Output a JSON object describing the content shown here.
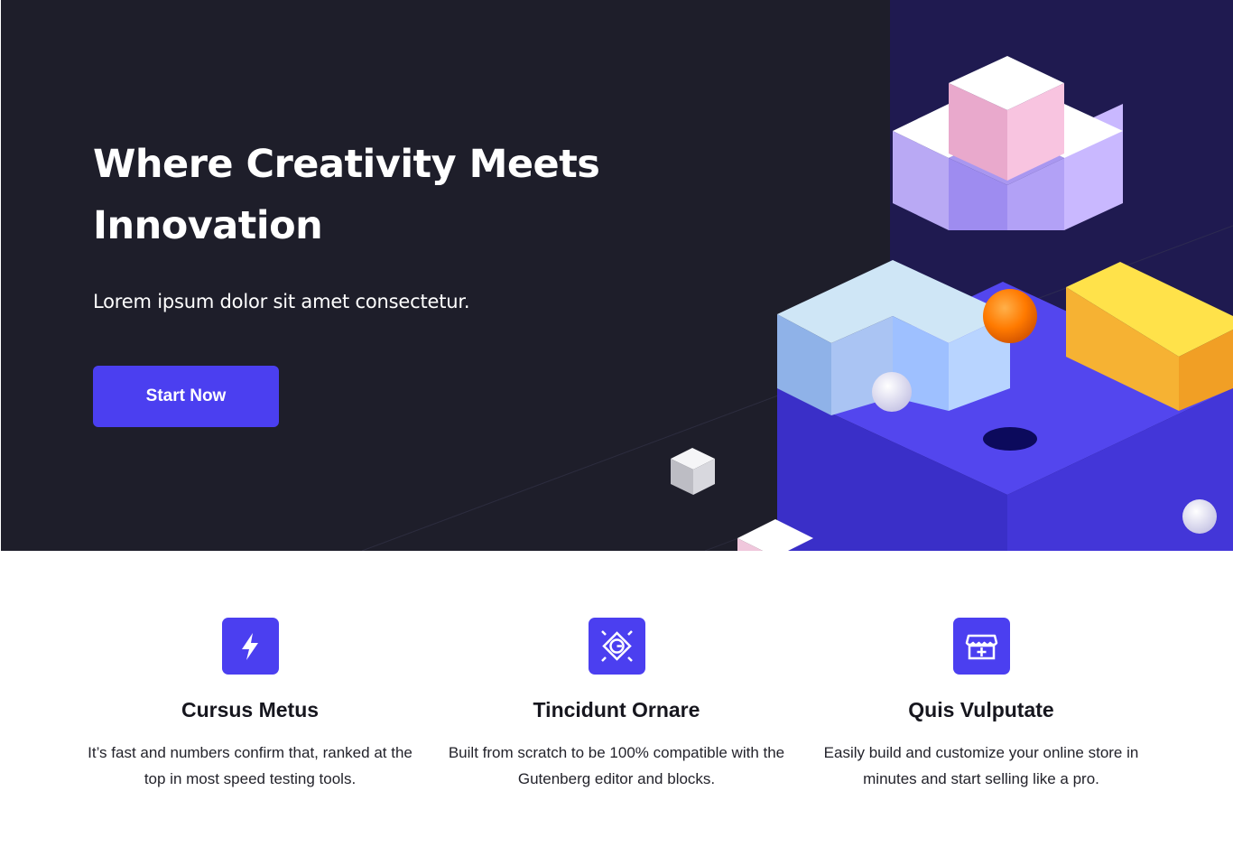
{
  "hero": {
    "title": "Where Creativity Meets\nInnovation",
    "subtitle": "Lorem ipsum dolor sit amet consectetur.",
    "cta_label": "Start Now"
  },
  "features": [
    {
      "icon": "lightning-bolt-icon",
      "title": "Cursus Metus",
      "description": "It’s fast and numbers confirm that, ranked at the top in most speed testing tools."
    },
    {
      "icon": "gutenberg-block-icon",
      "title": "Tincidunt Ornare",
      "description": "Built from scratch to be 100% compatible with the Gutenberg editor and blocks."
    },
    {
      "icon": "storefront-icon",
      "title": "Quis Vulputate",
      "description": "Easily build and customize your online store in minutes and start selling like a pro."
    }
  ],
  "colors": {
    "hero_background": "#1e1e2a",
    "hero_panel": "#1f1a50",
    "accent": "#4b3ff0",
    "text_dark": "#16161e"
  }
}
